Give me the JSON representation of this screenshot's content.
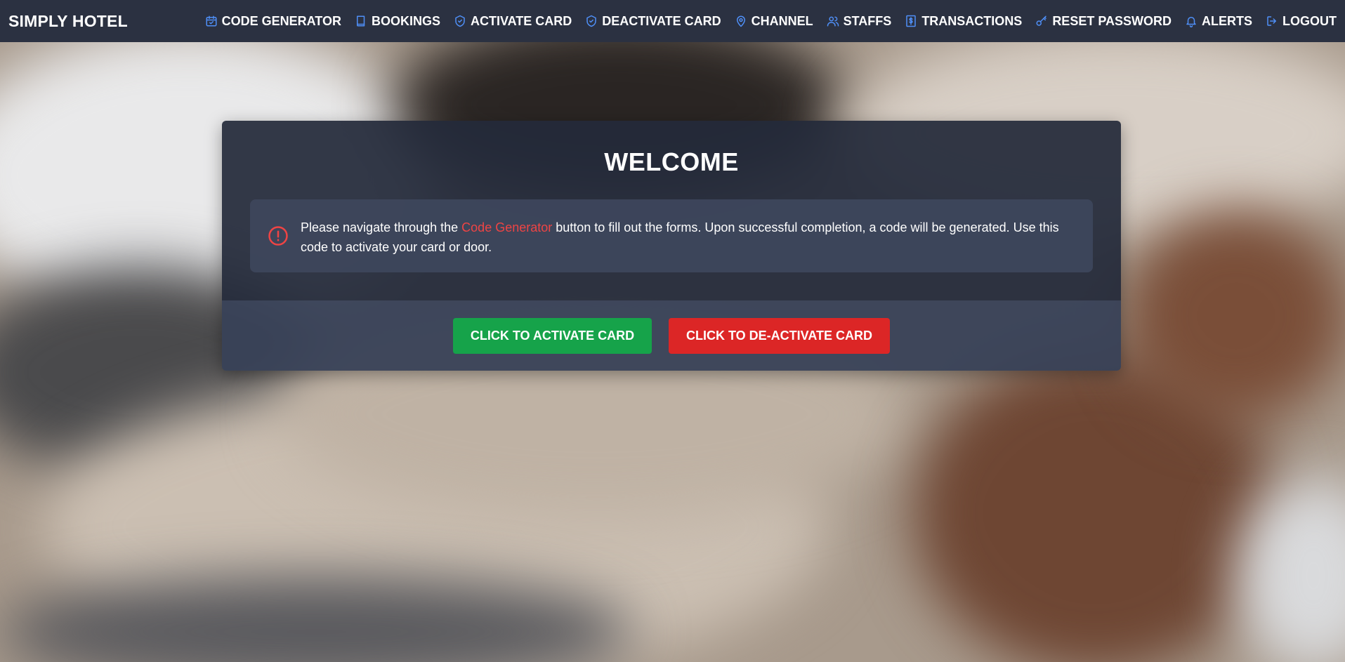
{
  "app": {
    "brand": "SIMPLY HOTEL"
  },
  "nav": {
    "items": [
      {
        "label": "CODE GENERATOR",
        "icon": "calendar-icon"
      },
      {
        "label": "BOOKINGS",
        "icon": "book-icon"
      },
      {
        "label": "ACTIVATE CARD",
        "icon": "shield-check-icon"
      },
      {
        "label": "DEACTIVATE CARD",
        "icon": "shield-check-icon"
      },
      {
        "label": "CHANNEL",
        "icon": "map-pin-icon"
      },
      {
        "label": "STAFFS",
        "icon": "users-icon"
      },
      {
        "label": "TRANSACTIONS",
        "icon": "dollar-receipt-icon"
      },
      {
        "label": "RESET PASSWORD",
        "icon": "key-icon"
      },
      {
        "label": "ALERTS",
        "icon": "bell-icon"
      },
      {
        "label": "LOGOUT",
        "icon": "logout-icon"
      }
    ]
  },
  "welcome": {
    "title": "WELCOME",
    "alert": {
      "icon": "alert-circle-icon",
      "text_before": "Please navigate through the ",
      "link": "Code Generator",
      "text_after": " button to fill out the forms. Upon successful completion, a code will be generated. Use this code to activate your card or door."
    },
    "buttons": {
      "activate": "CLICK TO ACTIVATE CARD",
      "deactivate": "CLICK TO DE-ACTIVATE CARD"
    }
  },
  "colors": {
    "navbar": "#2b3141",
    "icon_accent": "#4f8ff7",
    "alert_accent": "#ef4444",
    "activate_button": "#16a34a",
    "deactivate_button": "#dc2626"
  }
}
